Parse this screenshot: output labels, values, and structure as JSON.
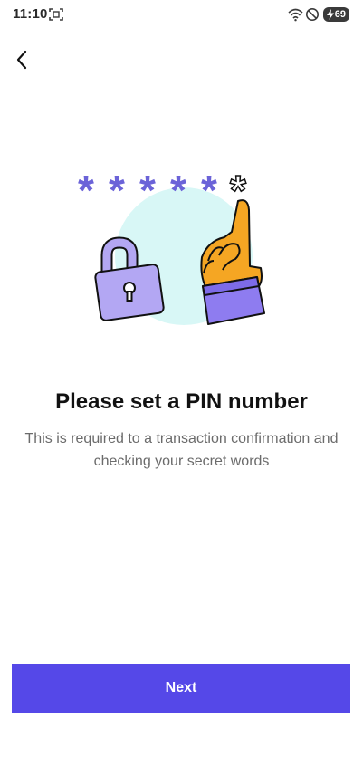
{
  "status_bar": {
    "time": "11:10",
    "battery": "69",
    "icons": [
      "screenshot-icon",
      "wifi-icon",
      "do-not-disturb-icon",
      "battery-icon"
    ]
  },
  "nav": {
    "back_icon": "chevron-left-icon"
  },
  "illustration": {
    "icon": "pin-lock-illustration",
    "pin_chars": [
      "*",
      "*",
      "*",
      "*",
      "*",
      "*"
    ]
  },
  "content": {
    "title": "Please set a PIN number",
    "subtitle": "This is required to a transaction confirmation and checking your secret words"
  },
  "footer": {
    "next_label": "Next"
  },
  "colors": {
    "accent": "#5548e8",
    "asterisk": "#6b63d8",
    "circle": "#d8f7f6",
    "lock": "#b3a7f3",
    "hand": "#f5a623",
    "sleeve": "#8e7cf0"
  }
}
